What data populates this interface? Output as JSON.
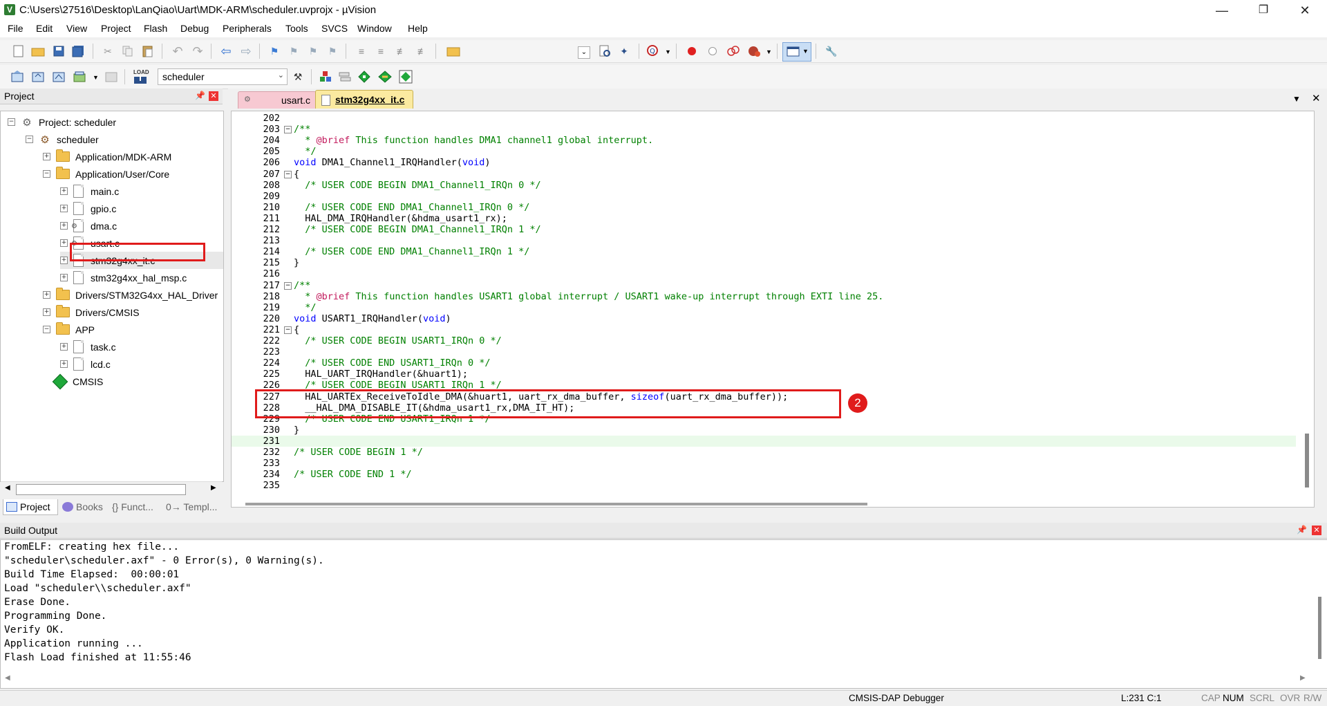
{
  "title": "C:\\Users\\27516\\Desktop\\LanQiao\\Uart\\MDK-ARM\\scheduler.uvprojx - µVision",
  "window_controls": {
    "minimize": "—",
    "maximize": "❐",
    "close": "✕"
  },
  "menu": [
    "File",
    "Edit",
    "View",
    "Project",
    "Flash",
    "Debug",
    "Peripherals",
    "Tools",
    "SVCS",
    "Window",
    "Help"
  ],
  "target_select": "scheduler",
  "project_panel": {
    "title": "Project",
    "tree": [
      {
        "label": "Project: scheduler",
        "icon": "project-icon",
        "expander": "−"
      },
      {
        "label": "scheduler",
        "icon": "target-gear-icon",
        "expander": "−"
      },
      {
        "label": "Application/MDK-ARM",
        "icon": "folder-icon",
        "expander": "+"
      },
      {
        "label": "Application/User/Core",
        "icon": "folder-open-icon",
        "expander": "−"
      },
      {
        "label": "main.c",
        "icon": "file-icon",
        "expander": "+"
      },
      {
        "label": "gpio.c",
        "icon": "file-icon",
        "expander": "+"
      },
      {
        "label": "dma.c",
        "icon": "file-gear-icon",
        "expander": "+"
      },
      {
        "label": "usart.c",
        "icon": "file-gear-icon",
        "expander": "+"
      },
      {
        "label": "stm32g4xx_it.c",
        "icon": "file-icon",
        "expander": "+"
      },
      {
        "label": "stm32g4xx_hal_msp.c",
        "icon": "file-icon",
        "expander": "+"
      },
      {
        "label": "Drivers/STM32G4xx_HAL_Driver",
        "icon": "folder-icon",
        "expander": "+"
      },
      {
        "label": "Drivers/CMSIS",
        "icon": "folder-icon",
        "expander": "+"
      },
      {
        "label": "APP",
        "icon": "folder-open-icon",
        "expander": "−"
      },
      {
        "label": "task.c",
        "icon": "file-icon",
        "expander": "+"
      },
      {
        "label": "lcd.c",
        "icon": "file-icon",
        "expander": "+"
      },
      {
        "label": "CMSIS",
        "icon": "cmsis-diamond-icon",
        "expander": ""
      }
    ],
    "bottom_tabs": [
      "Project",
      "Books",
      "{} Funct...",
      "0→ Templ..."
    ]
  },
  "editor": {
    "tabs": [
      "usart.c",
      "stm32g4xx_it.c"
    ],
    "active_tab": "stm32g4xx_it.c",
    "lines": [
      {
        "n": "202",
        "fold": "",
        "parts": []
      },
      {
        "n": "203",
        "fold": "−",
        "parts": [
          {
            "t": "/**",
            "c": "cm"
          }
        ]
      },
      {
        "n": "204",
        "fold": "",
        "parts": [
          {
            "t": "  * ",
            "c": "cm"
          },
          {
            "t": "@brief",
            "c": "at"
          },
          {
            "t": " This function handles DMA1 channel1 global interrupt.",
            "c": "cm"
          }
        ]
      },
      {
        "n": "205",
        "fold": "",
        "parts": [
          {
            "t": "  */",
            "c": "cm"
          }
        ]
      },
      {
        "n": "206",
        "fold": "",
        "parts": [
          {
            "t": "void",
            "c": "kw"
          },
          {
            "t": " DMA1_Channel1_IRQHandler(",
            "c": ""
          },
          {
            "t": "void",
            "c": "kw"
          },
          {
            "t": ")",
            "c": ""
          }
        ]
      },
      {
        "n": "207",
        "fold": "−",
        "parts": [
          {
            "t": "{",
            "c": ""
          }
        ]
      },
      {
        "n": "208",
        "fold": "",
        "parts": [
          {
            "t": "  /* USER CODE BEGIN DMA1_Channel1_IRQn 0 */",
            "c": "cm"
          }
        ]
      },
      {
        "n": "209",
        "fold": "",
        "parts": []
      },
      {
        "n": "210",
        "fold": "",
        "parts": [
          {
            "t": "  /* USER CODE END DMA1_Channel1_IRQn 0 */",
            "c": "cm"
          }
        ]
      },
      {
        "n": "211",
        "fold": "",
        "parts": [
          {
            "t": "  HAL_DMA_IRQHandler(&hdma_usart1_rx);",
            "c": ""
          }
        ]
      },
      {
        "n": "212",
        "fold": "",
        "parts": [
          {
            "t": "  /* USER CODE BEGIN DMA1_Channel1_IRQn 1 */",
            "c": "cm"
          }
        ]
      },
      {
        "n": "213",
        "fold": "",
        "parts": []
      },
      {
        "n": "214",
        "fold": "",
        "parts": [
          {
            "t": "  /* USER CODE END DMA1_Channel1_IRQn 1 */",
            "c": "cm"
          }
        ]
      },
      {
        "n": "215",
        "fold": "",
        "parts": [
          {
            "t": "}",
            "c": ""
          }
        ]
      },
      {
        "n": "216",
        "fold": "",
        "parts": []
      },
      {
        "n": "217",
        "fold": "−",
        "parts": [
          {
            "t": "/**",
            "c": "cm"
          }
        ]
      },
      {
        "n": "218",
        "fold": "",
        "parts": [
          {
            "t": "  * ",
            "c": "cm"
          },
          {
            "t": "@brief",
            "c": "at"
          },
          {
            "t": " This function handles USART1 global interrupt / USART1 wake-up interrupt through EXTI line 25.",
            "c": "cm"
          }
        ]
      },
      {
        "n": "219",
        "fold": "",
        "parts": [
          {
            "t": "  */",
            "c": "cm"
          }
        ]
      },
      {
        "n": "220",
        "fold": "",
        "parts": [
          {
            "t": "void",
            "c": "kw"
          },
          {
            "t": " USART1_IRQHandler(",
            "c": ""
          },
          {
            "t": "void",
            "c": "kw"
          },
          {
            "t": ")",
            "c": ""
          }
        ]
      },
      {
        "n": "221",
        "fold": "−",
        "parts": [
          {
            "t": "{",
            "c": ""
          }
        ]
      },
      {
        "n": "222",
        "fold": "",
        "parts": [
          {
            "t": "  /* USER CODE BEGIN USART1_IRQn 0 */",
            "c": "cm"
          }
        ]
      },
      {
        "n": "223",
        "fold": "",
        "parts": []
      },
      {
        "n": "224",
        "fold": "",
        "parts": [
          {
            "t": "  /* USER CODE END USART1_IRQn 0 */",
            "c": "cm"
          }
        ]
      },
      {
        "n": "225",
        "fold": "",
        "parts": [
          {
            "t": "  HAL_UART_IRQHandler(&huart1);",
            "c": ""
          }
        ]
      },
      {
        "n": "226",
        "fold": "",
        "parts": [
          {
            "t": "  /* USER CODE BEGIN USART1_IRQn 1 */",
            "c": "cm"
          }
        ]
      },
      {
        "n": "227",
        "fold": "",
        "parts": [
          {
            "t": "  HAL_UARTEx_ReceiveToIdle_DMA(&huart1, uart_rx_dma_buffer, ",
            "c": ""
          },
          {
            "t": "sizeof",
            "c": "kw"
          },
          {
            "t": "(uart_rx_dma_buffer));",
            "c": ""
          }
        ]
      },
      {
        "n": "228",
        "fold": "",
        "parts": [
          {
            "t": "  __HAL_DMA_DISABLE_IT(&hdma_usart1_rx,DMA_IT_HT);",
            "c": ""
          }
        ]
      },
      {
        "n": "229",
        "fold": "",
        "parts": [
          {
            "t": "  /* USER CODE END USART1_IRQn 1 */",
            "c": "cm"
          }
        ]
      },
      {
        "n": "230",
        "fold": "",
        "parts": [
          {
            "t": "}",
            "c": ""
          }
        ]
      },
      {
        "n": "231",
        "fold": "",
        "parts": []
      },
      {
        "n": "232",
        "fold": "",
        "parts": [
          {
            "t": "/* USER CODE BEGIN 1 */",
            "c": "cm"
          }
        ]
      },
      {
        "n": "233",
        "fold": "",
        "parts": []
      },
      {
        "n": "234",
        "fold": "",
        "parts": [
          {
            "t": "/* USER CODE END 1 */",
            "c": "cm"
          }
        ]
      },
      {
        "n": "235",
        "fold": "",
        "parts": []
      }
    ],
    "annotation_marker": "2"
  },
  "build_output": {
    "title": "Build Output",
    "lines": [
      "FromELF: creating hex file...",
      "\"scheduler\\scheduler.axf\" - 0 Error(s), 0 Warning(s).",
      "Build Time Elapsed:  00:00:01",
      "Load \"scheduler\\\\scheduler.axf\"",
      "Erase Done.",
      "Programming Done.",
      "Verify OK.",
      "Application running ...",
      "Flash Load finished at 11:55:46"
    ]
  },
  "statusbar": {
    "debugger": "CMSIS-DAP Debugger",
    "position": "L:231 C:1",
    "indicators": [
      "CAP",
      "NUM",
      "SCRL",
      "OVR",
      "R/W"
    ]
  },
  "colors": {
    "highlight_box": "#e01b1b",
    "comment": "#008000",
    "keyword": "#0000ff",
    "current_line": "#eafaea"
  }
}
